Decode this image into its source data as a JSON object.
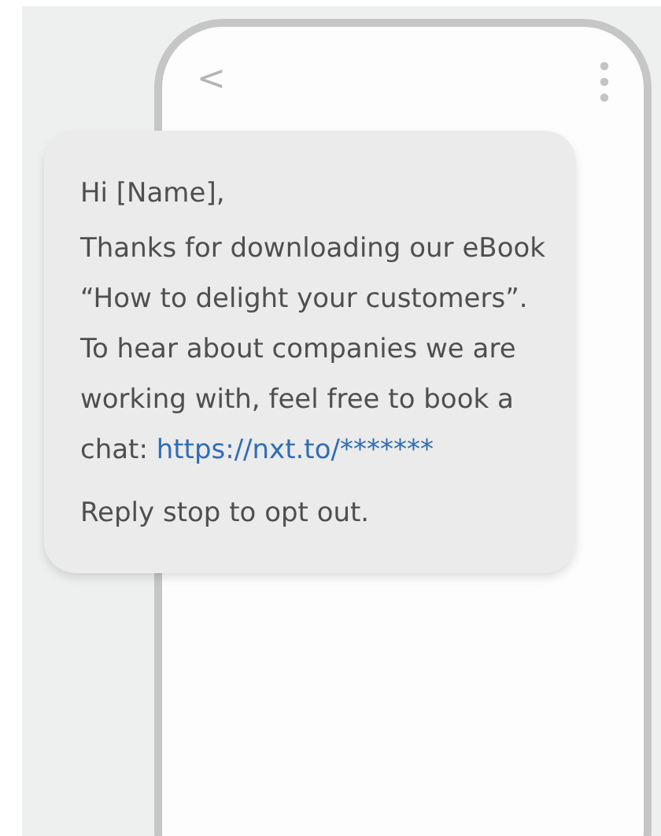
{
  "phone": {
    "back_icon": "<"
  },
  "message": {
    "greeting": "Hi [Name],",
    "body": "Thanks for downloading our eBook “How to delight your customers”. To hear about companies we are working with, feel free to book a chat:",
    "link": "https://nxt.to/*******",
    "footer": "Reply stop to opt out."
  }
}
